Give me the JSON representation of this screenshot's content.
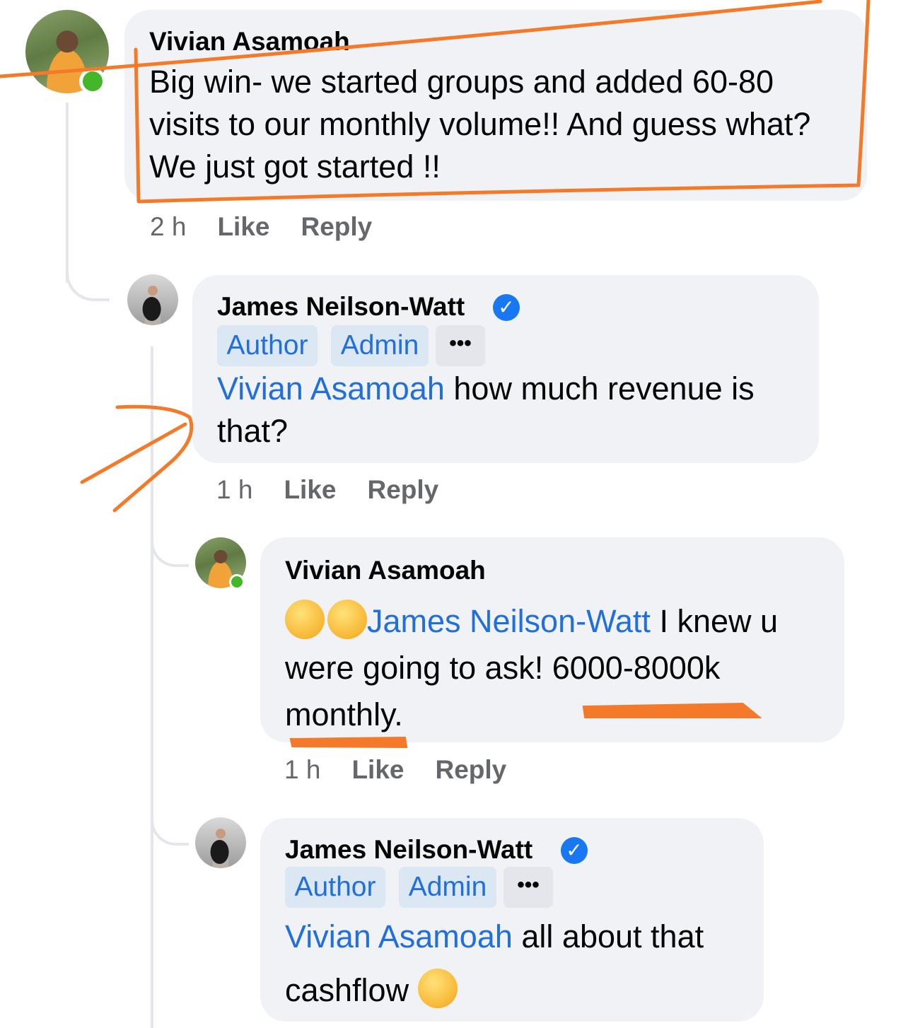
{
  "comments": [
    {
      "author": "Vivian Asamoah",
      "text": "Big win- we started groups and added 60-80 visits to our monthly volume!! And guess what? We just got started !!",
      "time": "2 h",
      "like_label": "Like",
      "reply_label": "Reply",
      "online": true
    },
    {
      "author": "James Neilson-Watt",
      "verified": true,
      "badges": [
        "Author",
        "Admin"
      ],
      "more_label": "•••",
      "mention": "Vivian Asamoah",
      "text": "how much revenue is that?",
      "time": "1 h",
      "like_label": "Like",
      "reply_label": "Reply"
    },
    {
      "author": "Vivian Asamoah",
      "online": true,
      "emojis": [
        "laughing-tears-emoji",
        "laughing-tears-emoji"
      ],
      "mention": "James Neilson-Watt",
      "text": "I knew u were going to ask! 6000-8000k monthly.",
      "time": "1 h",
      "like_label": "Like",
      "reply_label": "Reply"
    },
    {
      "author": "James Neilson-Watt",
      "verified": true,
      "badges": [
        "Author",
        "Admin"
      ],
      "more_label": "•••",
      "mention": "Vivian Asamoah",
      "text": "all about that cashflow",
      "emoji": "winking-emoji"
    }
  ],
  "colors": {
    "bubble": "#f0f2f5",
    "mention": "#216fdb",
    "badge_bg": "#dbe7f2",
    "meta_text": "#65676b",
    "online": "#42b72a",
    "verified": "#1877f2",
    "annotation": "#f47a2a"
  }
}
